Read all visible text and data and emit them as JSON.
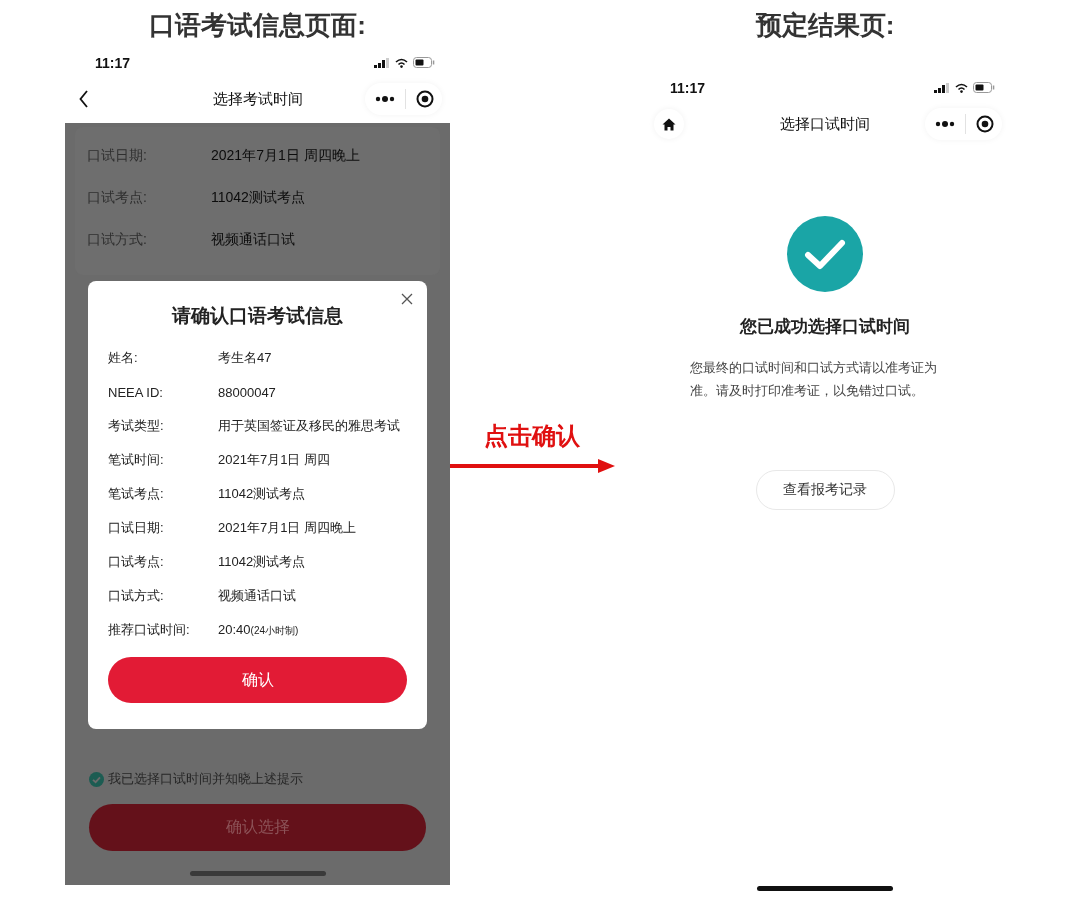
{
  "left": {
    "heading": "口语考试信息页面:",
    "status_time": "11:17",
    "nav_title": "选择考试时间",
    "background_rows": [
      {
        "label": "口试日期:",
        "value": "2021年7月1日 周四晚上"
      },
      {
        "label": "口试考点:",
        "value": "11042测试考点"
      },
      {
        "label": "口试方式:",
        "value": "视频通话口试"
      }
    ],
    "dialog": {
      "title": "请确认口语考试信息",
      "rows": [
        {
          "label": "姓名:",
          "value": "考生名47"
        },
        {
          "label": "NEEA ID:",
          "value": "88000047"
        },
        {
          "label": "考试类型:",
          "value": "用于英国签证及移民的雅思考试"
        },
        {
          "label": "笔试时间:",
          "value": "2021年7月1日 周四"
        },
        {
          "label": "笔试考点:",
          "value": "11042测试考点"
        },
        {
          "label": "口试日期:",
          "value": "2021年7月1日 周四晚上"
        },
        {
          "label": "口试考点:",
          "value": "11042测试考点"
        },
        {
          "label": "口试方式:",
          "value": "视频通话口试"
        },
        {
          "label": "推荐口试时间:",
          "value": "20:40",
          "note": "(24小时制)"
        }
      ],
      "confirm_button": "确认"
    },
    "agreement": {
      "checked": true,
      "text": "我已选择口试时间并知晓上述提示"
    },
    "submit_button": "确认选择"
  },
  "arrow": {
    "label": "点击确认"
  },
  "right": {
    "heading": "预定结果页:",
    "status_time": "11:17",
    "nav_title": "选择口试时间",
    "result_title": "您已成功选择口试时间",
    "result_text": "您最终的口试时间和口试方式请以准考证为准。请及时打印准考证，以免错过口试。",
    "records_button": "查看报考记录"
  }
}
